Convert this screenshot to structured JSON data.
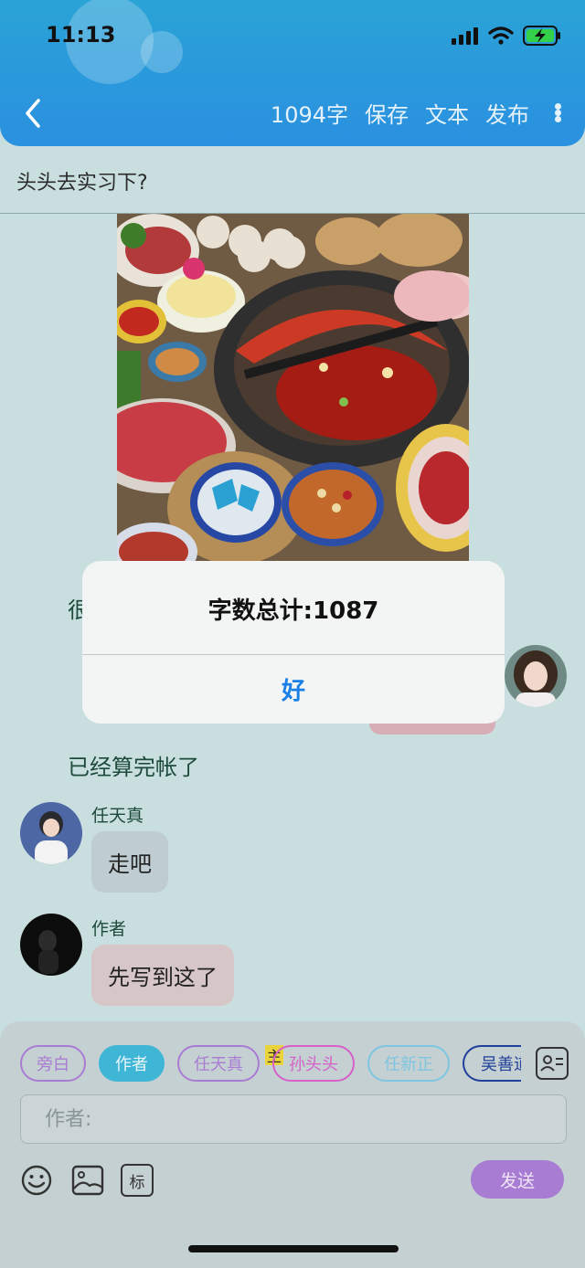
{
  "status": {
    "time": "11:13"
  },
  "nav": {
    "word_count": "1094字",
    "save": "保存",
    "text": "文本",
    "publish": "发布"
  },
  "title": "头头去实习下?",
  "messages": {
    "partial": "很",
    "plain": "已经算完帐了",
    "m1": {
      "sender": "任天真",
      "text": "走吧"
    },
    "m2": {
      "sender": "作者",
      "text": "先写到这了"
    }
  },
  "dialog": {
    "message": "字数总计:1087",
    "ok": "好"
  },
  "roles": [
    {
      "label": "旁白",
      "color": "#a97cd3",
      "active": false
    },
    {
      "label": "作者",
      "color": "#3fb6d6",
      "active": true
    },
    {
      "label": "任天真",
      "color": "#a97cd3",
      "active": false
    },
    {
      "label": "孙头头",
      "color": "#d65fc9",
      "active": false
    },
    {
      "label": "任新正",
      "color": "#7ec5e0",
      "active": false
    },
    {
      "label": "吴善道",
      "color": "#1f3f9a",
      "active": false
    }
  ],
  "host_badge": "主",
  "input": {
    "placeholder": "作者:"
  },
  "tools": {
    "mark": "标"
  },
  "send": "发送"
}
